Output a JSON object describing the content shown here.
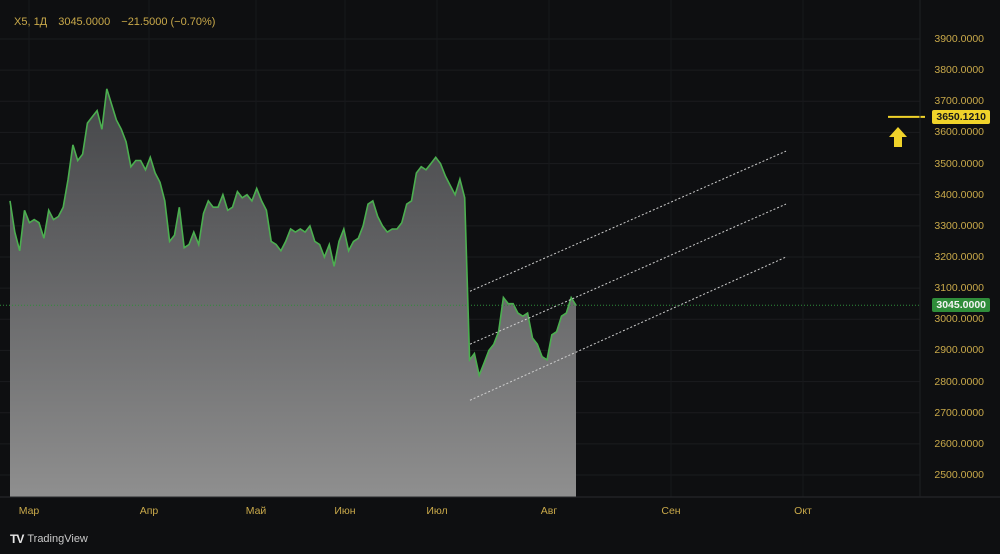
{
  "header": {
    "symbol": "X5, 1Д",
    "last": "3045.0000",
    "change": "−21.5000 (−0.70%)"
  },
  "y_ticks": [
    "3900.0000",
    "3800.0000",
    "3700.0000",
    "3600.0000",
    "3500.0000",
    "3400.0000",
    "3300.0000",
    "3200.0000",
    "3100.0000",
    "3000.0000",
    "2900.0000",
    "2800.0000",
    "2700.0000",
    "2600.0000",
    "2500.0000"
  ],
  "x_ticks": [
    "Мар",
    "Апр",
    "Май",
    "Июн",
    "Июл",
    "Авг",
    "Сен",
    "Окт"
  ],
  "price_tags": {
    "current": "3045.0000",
    "target": "3650.1210"
  },
  "brand": {
    "logo": "TV",
    "name": "TradingView"
  },
  "colors": {
    "line": "#4caf50",
    "channel": "#cfcfcf",
    "target_line": "#f0d32a",
    "current_line": "#2f8d3a",
    "axis_text": "#c9a94a"
  },
  "chart_data": {
    "type": "area",
    "title": "",
    "xlabel": "",
    "ylabel": "",
    "ylim": [
      2400,
      3950
    ],
    "x_range": [
      "2024-02-23",
      "2024-10-14"
    ],
    "series": [
      {
        "values": [
          [
            "2024-02-23",
            3380
          ],
          [
            "2024-02-24",
            3280
          ],
          [
            "2024-02-25",
            3220
          ],
          [
            "2024-02-26",
            3350
          ],
          [
            "2024-02-27",
            3310
          ],
          [
            "2024-02-28",
            3320
          ],
          [
            "2024-02-29",
            3310
          ],
          [
            "2024-03-01",
            3260
          ],
          [
            "2024-03-02",
            3350
          ],
          [
            "2024-03-03",
            3320
          ],
          [
            "2024-03-04",
            3330
          ],
          [
            "2024-03-05",
            3360
          ],
          [
            "2024-03-06",
            3450
          ],
          [
            "2024-03-07",
            3560
          ],
          [
            "2024-03-08",
            3510
          ],
          [
            "2024-03-09",
            3530
          ],
          [
            "2024-03-10",
            3630
          ],
          [
            "2024-03-11",
            3650
          ],
          [
            "2024-03-12",
            3670
          ],
          [
            "2024-03-13",
            3610
          ],
          [
            "2024-03-14",
            3740
          ],
          [
            "2024-03-15",
            3690
          ],
          [
            "2024-03-16",
            3640
          ],
          [
            "2024-03-17",
            3610
          ],
          [
            "2024-03-18",
            3570
          ],
          [
            "2024-03-19",
            3490
          ],
          [
            "2024-03-20",
            3510
          ],
          [
            "2024-03-21",
            3510
          ],
          [
            "2024-03-22",
            3480
          ],
          [
            "2024-03-23",
            3520
          ],
          [
            "2024-03-24",
            3470
          ],
          [
            "2024-03-25",
            3440
          ],
          [
            "2024-03-26",
            3380
          ],
          [
            "2024-03-27",
            3250
          ],
          [
            "2024-03-28",
            3270
          ],
          [
            "2024-03-29",
            3360
          ],
          [
            "2024-03-30",
            3230
          ],
          [
            "2024-03-31",
            3240
          ],
          [
            "2024-04-01",
            3280
          ],
          [
            "2024-04-02",
            3240
          ],
          [
            "2024-04-03",
            3340
          ],
          [
            "2024-04-04",
            3380
          ],
          [
            "2024-04-05",
            3360
          ],
          [
            "2024-04-06",
            3360
          ],
          [
            "2024-04-07",
            3400
          ],
          [
            "2024-04-08",
            3350
          ],
          [
            "2024-04-09",
            3360
          ],
          [
            "2024-04-10",
            3410
          ],
          [
            "2024-04-11",
            3390
          ],
          [
            "2024-04-12",
            3400
          ],
          [
            "2024-04-13",
            3380
          ],
          [
            "2024-04-14",
            3420
          ],
          [
            "2024-04-15",
            3380
          ],
          [
            "2024-04-16",
            3350
          ],
          [
            "2024-04-17",
            3250
          ],
          [
            "2024-04-18",
            3240
          ],
          [
            "2024-04-19",
            3220
          ],
          [
            "2024-04-20",
            3250
          ],
          [
            "2024-04-21",
            3290
          ],
          [
            "2024-04-22",
            3280
          ],
          [
            "2024-04-23",
            3290
          ],
          [
            "2024-04-24",
            3280
          ],
          [
            "2024-04-25",
            3300
          ],
          [
            "2024-04-26",
            3250
          ],
          [
            "2024-04-27",
            3240
          ],
          [
            "2024-04-28",
            3200
          ],
          [
            "2024-04-29",
            3240
          ],
          [
            "2024-04-30",
            3170
          ],
          [
            "2024-05-01",
            3250
          ],
          [
            "2024-05-02",
            3290
          ],
          [
            "2024-05-03",
            3220
          ],
          [
            "2024-05-04",
            3250
          ],
          [
            "2024-05-05",
            3260
          ],
          [
            "2024-05-06",
            3300
          ],
          [
            "2024-05-07",
            3370
          ],
          [
            "2024-05-08",
            3380
          ],
          [
            "2024-05-09",
            3330
          ],
          [
            "2024-05-10",
            3300
          ],
          [
            "2024-05-11",
            3280
          ],
          [
            "2024-05-12",
            3290
          ],
          [
            "2024-05-13",
            3290
          ],
          [
            "2024-05-14",
            3310
          ],
          [
            "2024-05-15",
            3370
          ],
          [
            "2024-05-16",
            3380
          ],
          [
            "2024-05-17",
            3470
          ],
          [
            "2024-05-18",
            3490
          ],
          [
            "2024-05-19",
            3480
          ],
          [
            "2024-05-20",
            3500
          ],
          [
            "2024-05-21",
            3520
          ],
          [
            "2024-05-22",
            3500
          ],
          [
            "2024-05-23",
            3460
          ],
          [
            "2024-05-24",
            3430
          ],
          [
            "2024-05-25",
            3400
          ],
          [
            "2024-05-26",
            3450
          ],
          [
            "2024-05-27",
            3390
          ],
          [
            "2024-05-28",
            2870
          ],
          [
            "2024-05-29",
            2890
          ],
          [
            "2024-05-30",
            2820
          ],
          [
            "2024-05-31",
            2860
          ],
          [
            "2024-06-01",
            2900
          ],
          [
            "2024-06-02",
            2920
          ],
          [
            "2024-06-03",
            2960
          ],
          [
            "2024-06-04",
            3070
          ],
          [
            "2024-06-05",
            3050
          ],
          [
            "2024-06-06",
            3050
          ],
          [
            "2024-06-07",
            3020
          ],
          [
            "2024-06-08",
            3010
          ],
          [
            "2024-06-09",
            3020
          ],
          [
            "2024-06-10",
            2940
          ],
          [
            "2024-06-11",
            2920
          ],
          [
            "2024-06-12",
            2880
          ],
          [
            "2024-06-13",
            2870
          ],
          [
            "2024-06-14",
            2950
          ],
          [
            "2024-06-15",
            2960
          ],
          [
            "2024-06-16",
            3010
          ],
          [
            "2024-06-17",
            3020
          ],
          [
            "2024-06-18",
            3070
          ],
          [
            "2024-06-19",
            3045
          ]
        ]
      }
    ],
    "channel": {
      "upper": [
        [
          "2024-06-22",
          3090
        ],
        [
          "2024-09-28",
          3540
        ]
      ],
      "middle": [
        [
          "2024-06-22",
          2920
        ],
        [
          "2024-09-28",
          3370
        ]
      ],
      "lower": [
        [
          "2024-06-22",
          2740
        ],
        [
          "2024-09-28",
          3200
        ]
      ]
    },
    "reference_lines": [
      {
        "label": "3045.0000",
        "value": 3045
      },
      {
        "label": "3650.1210",
        "value": 3650.121
      }
    ],
    "grid": true
  }
}
